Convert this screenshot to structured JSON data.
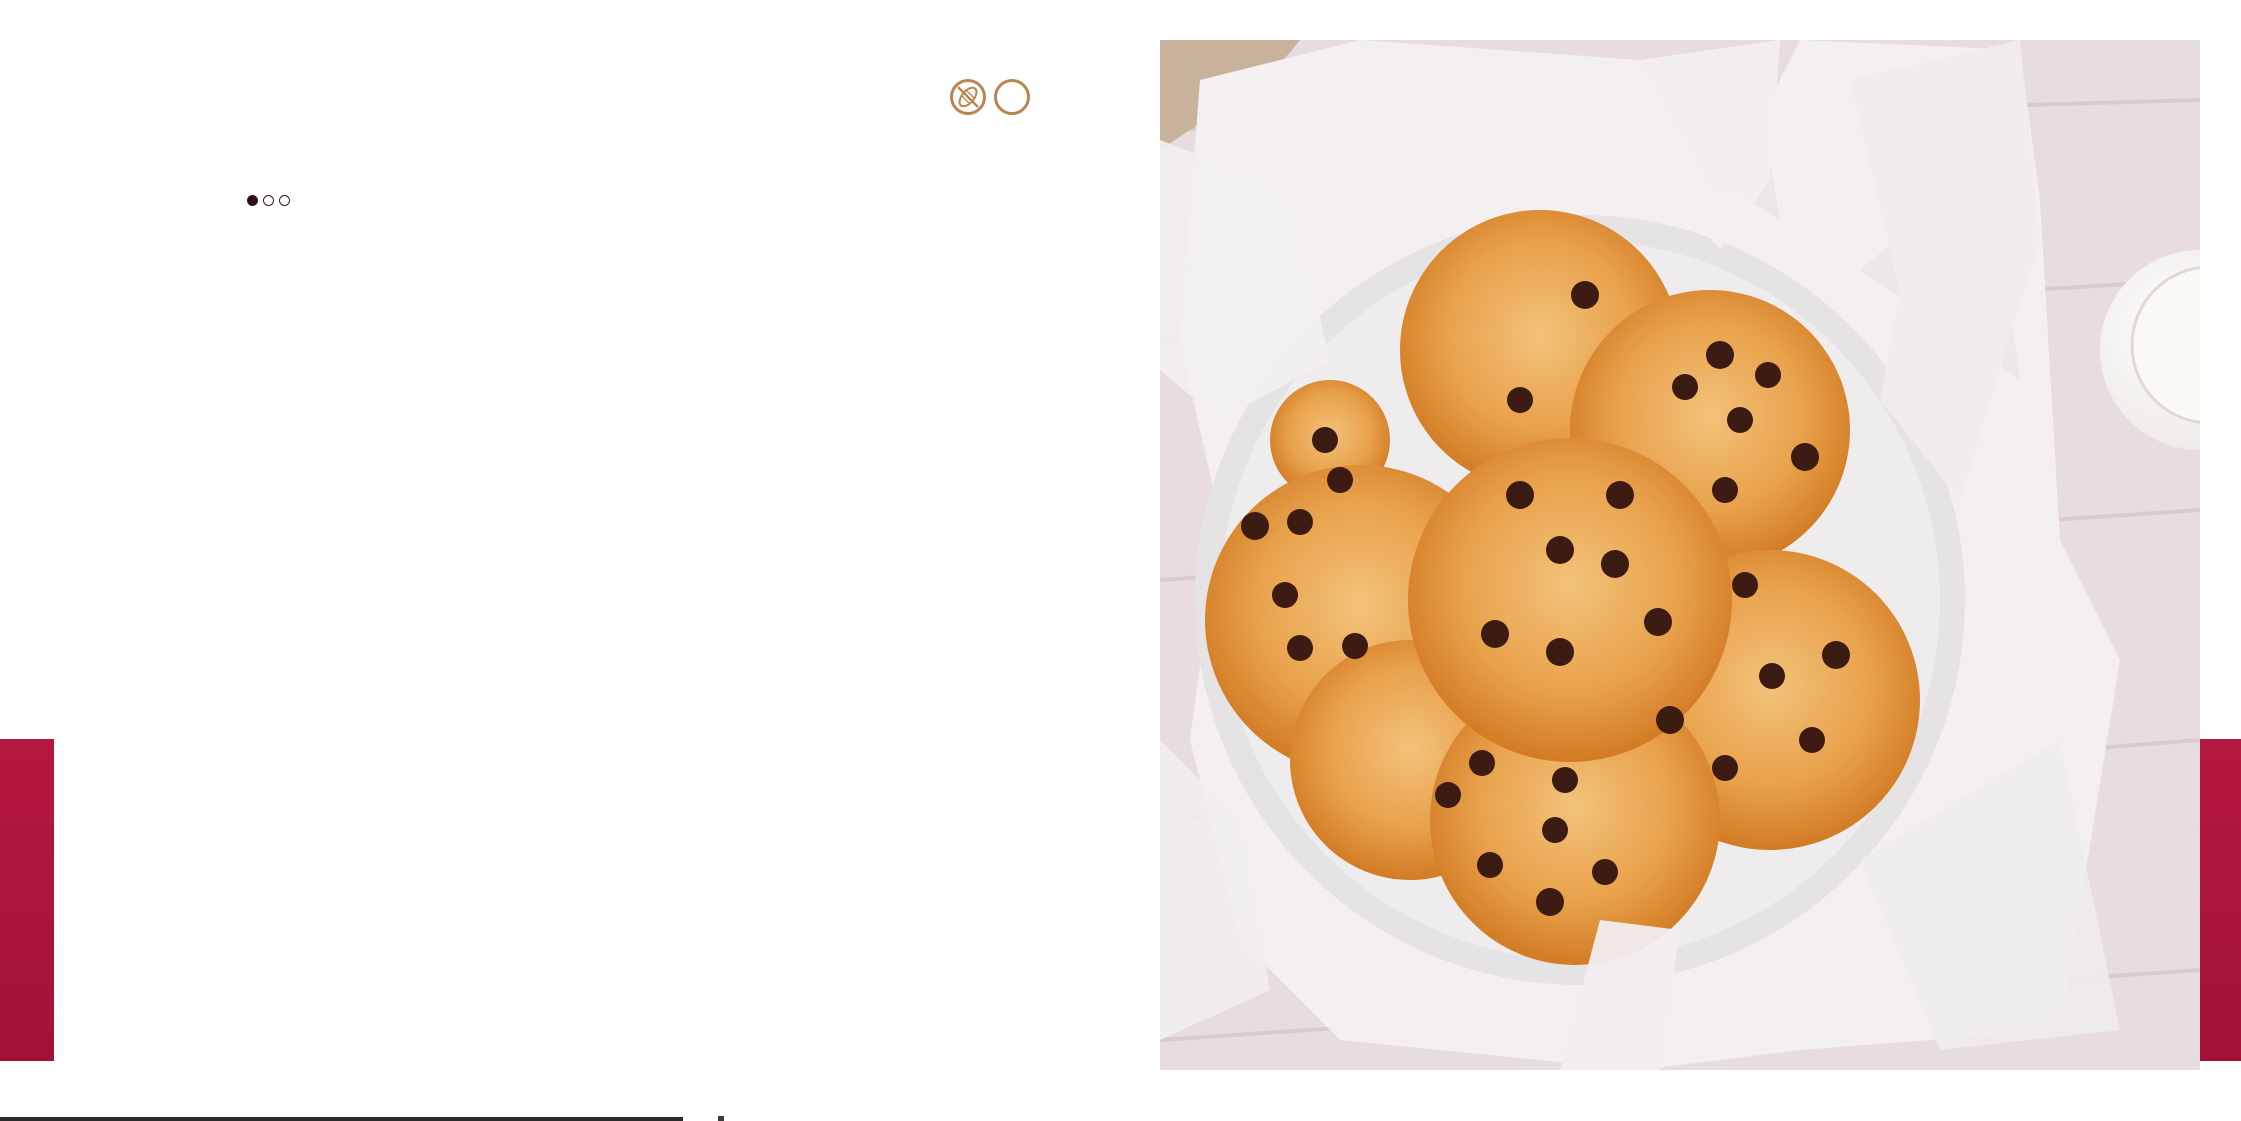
{
  "page": {
    "accent_color": "#a9143c",
    "badge_color": "#b98550",
    "icons": [
      "no-nuts-icon",
      "blank-badge-icon"
    ]
  },
  "pagination": {
    "total": 3,
    "active_index": 0
  },
  "photo": {
    "subject": "chocolate-chip-cookies-in-bowl-image"
  }
}
